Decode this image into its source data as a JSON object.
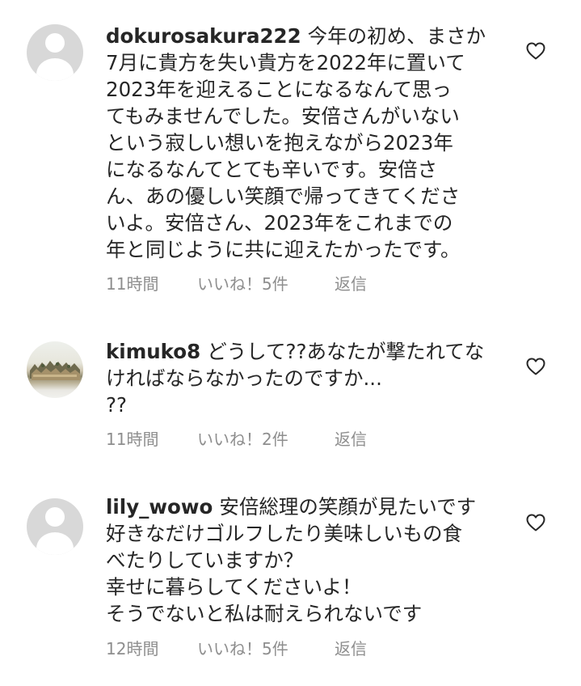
{
  "comments": [
    {
      "username": "dokurosakura222",
      "avatar": "default-avatar",
      "lines": [
        "今年の初め、まさか",
        "7月に貴方を失い貴方を2022年に置いて",
        "2023年を迎えることになるなんて思っ",
        "てもみませんでした。安倍さんがいない",
        "という寂しい想いを抱えながら2023年",
        "になるなんてとても辛いです。安倍さ",
        "ん、あの優しい笑顔で帰ってきてくださ",
        "いよ。安倍さん、2023年をこれまでの",
        "年と同じように共に迎えたかったです。"
      ],
      "time": "11時間",
      "likes": "いいね！5件",
      "reply": "返信"
    },
    {
      "username": "kimuko8",
      "avatar": "photo-avatar",
      "lines": [
        "どうして??あなたが撃たれてな",
        "ければならなかったのですか...",
        "??"
      ],
      "time": "11時間",
      "likes": "いいね！2件",
      "reply": "返信"
    },
    {
      "username": "lily_wowo",
      "avatar": "default-avatar",
      "lines": [
        "安倍総理の笑顔が見たいです",
        "好きなだけゴルフしたり美味しいもの食",
        "べたりしていますか？",
        "幸せに暮らしてくださいよ！",
        "そうでないと私は耐えられないです"
      ],
      "time": "12時間",
      "likes": "いいね！5件",
      "reply": "返信"
    }
  ],
  "icons": {
    "like": "heart-outline-icon"
  },
  "colors": {
    "text": "#262626",
    "meta": "#8e8e8e",
    "avatar_placeholder": "#d8d8d8"
  }
}
